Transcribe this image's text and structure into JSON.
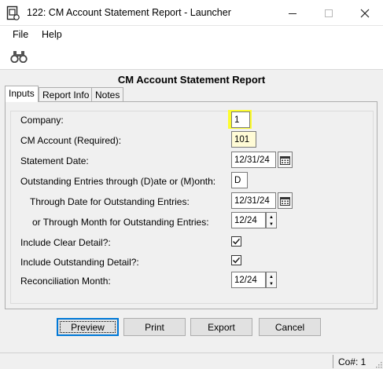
{
  "window": {
    "title": "122: CM Account Statement Report - Launcher",
    "app_icon": "document-icon",
    "controls": [
      "minimize-icon",
      "maximize-icon",
      "close-icon"
    ]
  },
  "menu": {
    "file": "File",
    "help": "Help"
  },
  "toolbar": {
    "icon": "binoculars-icon"
  },
  "report_title": "CM Account Statement Report",
  "tabs": [
    {
      "label": "Inputs",
      "active": true
    },
    {
      "label": "Report Info",
      "active": false
    },
    {
      "label": "Notes",
      "active": false
    }
  ],
  "form": {
    "company": {
      "label": "Company:",
      "value": "1"
    },
    "cm_account": {
      "label": "CM Account (Required):",
      "value": "101"
    },
    "statement_date": {
      "label": "Statement Date:",
      "value": "12/31/24"
    },
    "outstanding_entries": {
      "label": "Outstanding Entries through (D)ate or (M)onth:",
      "value": "D"
    },
    "through_date": {
      "label": "Through Date for Outstanding Entries:",
      "value": "12/31/24"
    },
    "through_month": {
      "label": "or Through Month for Outstanding Entries:",
      "value": "12/24"
    },
    "include_clear": {
      "label": "Include Clear Detail?:",
      "checked": true
    },
    "include_outstanding": {
      "label": "Include Outstanding Detail?:",
      "checked": true
    },
    "reconciliation_month": {
      "label": "Reconciliation Month:",
      "value": "12/24"
    }
  },
  "buttons": {
    "preview": "Preview",
    "print": "Print",
    "export": "Export",
    "cancel": "Cancel"
  },
  "status": {
    "company": "Co#: 1"
  },
  "colors": {
    "required_field": "#fffbd6",
    "highlight": "#fdfd2e",
    "focus_border": "#0078d7"
  }
}
